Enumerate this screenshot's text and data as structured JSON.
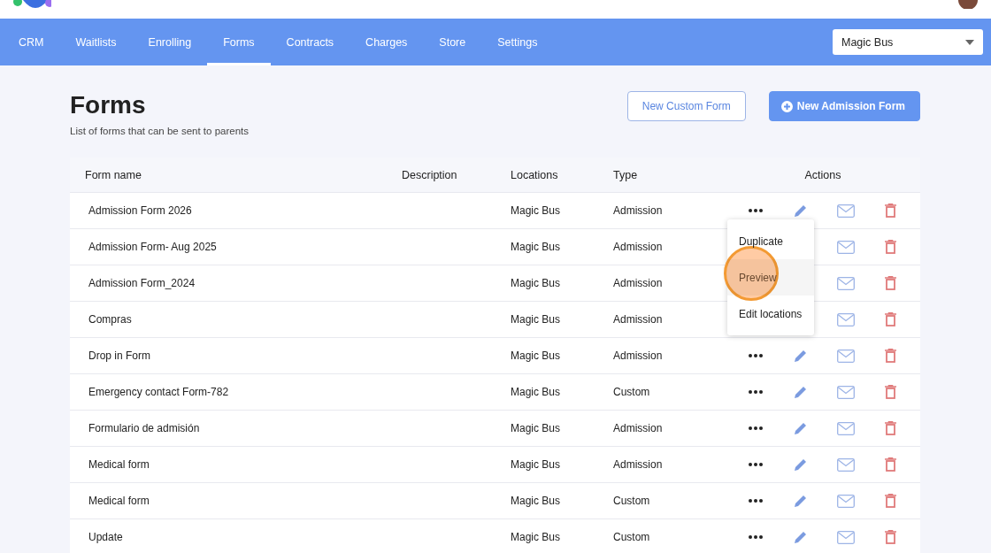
{
  "nav": {
    "tabs": [
      {
        "label": "CRM",
        "selected": false
      },
      {
        "label": "Waitlists",
        "selected": false
      },
      {
        "label": "Enrolling",
        "selected": false
      },
      {
        "label": "Forms",
        "selected": true
      },
      {
        "label": "Contracts",
        "selected": false
      },
      {
        "label": "Charges",
        "selected": false
      },
      {
        "label": "Store",
        "selected": false
      },
      {
        "label": "Settings",
        "selected": false
      }
    ],
    "location_select": {
      "value": "Magic Bus"
    }
  },
  "page": {
    "title": "Forms",
    "subtitle": "List of forms that can be sent to parents",
    "buttons": [
      {
        "label": "New Custom Form",
        "kind": "outline"
      },
      {
        "label": "New Admission Form",
        "kind": "primary"
      }
    ]
  },
  "table": {
    "columns": [
      "Form name",
      "Description",
      "Locations",
      "Type",
      "Actions"
    ],
    "rows": [
      {
        "name": "Admission Form 2026",
        "location": "Magic Bus",
        "type": "Admission",
        "row_menu": {
          "items": [
            {
              "label": "Duplicate",
              "selected": false
            },
            {
              "label": "Preview",
              "selected": true
            },
            {
              "label": "Edit locations",
              "selected": false
            }
          ]
        }
      },
      {
        "name": "Admission Form- Aug 2025",
        "location": "Magic Bus",
        "type": "Admission"
      },
      {
        "name": "Admission Form_2024",
        "location": "Magic Bus",
        "type": "Admission"
      },
      {
        "name": "Compras",
        "location": "Magic Bus",
        "type": "Admission"
      },
      {
        "name": "Drop in Form",
        "location": "Magic Bus",
        "type": "Admission"
      },
      {
        "name": "Emergency contact Form-782",
        "location": "Magic Bus",
        "type": "Custom"
      },
      {
        "name": "Formulario de admisión",
        "location": "Magic Bus",
        "type": "Admission"
      },
      {
        "name": "Medical form",
        "location": "Magic Bus",
        "type": "Admission"
      },
      {
        "name": "Medical form",
        "location": "Magic Bus",
        "type": "Custom"
      },
      {
        "name": "Update",
        "location": "Magic Bus",
        "type": "Custom"
      }
    ]
  }
}
